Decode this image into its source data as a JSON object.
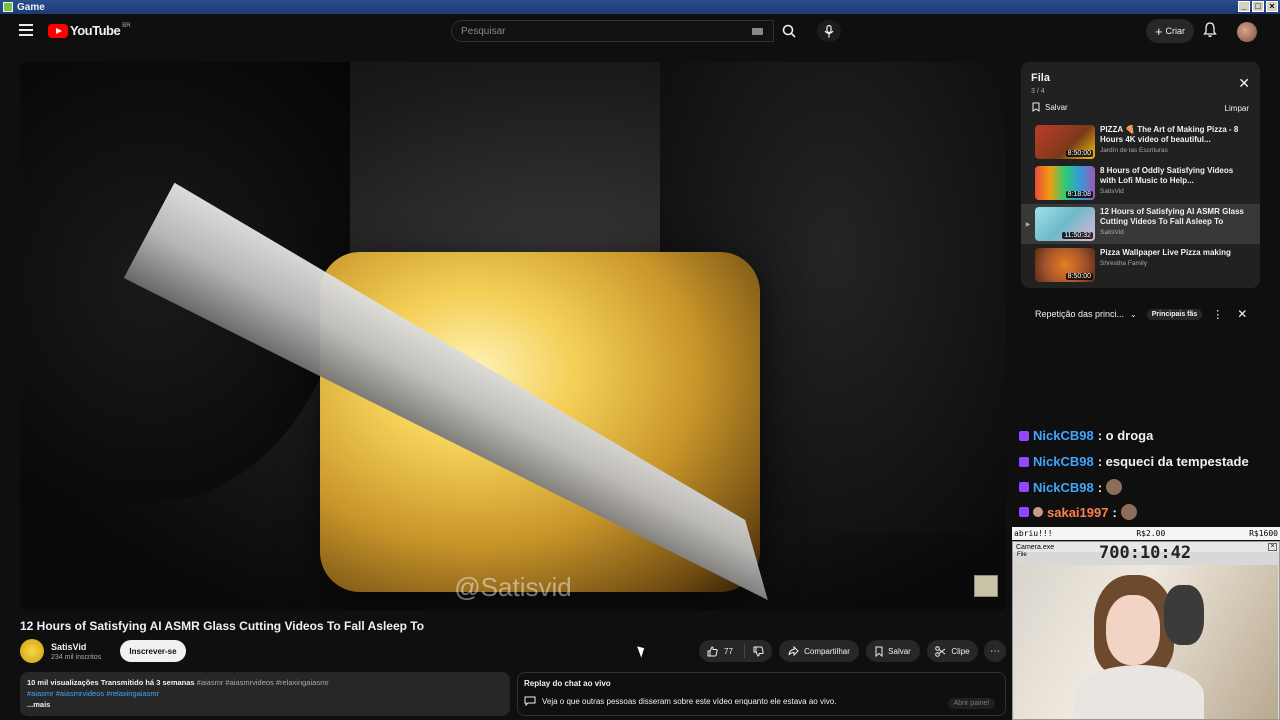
{
  "window": {
    "title": "Game"
  },
  "header": {
    "logo_text": "YouTube",
    "country": "BR",
    "search_placeholder": "Pesquisar",
    "create_label": "Criar"
  },
  "video": {
    "watermark": "@Satisvid",
    "title": "12 Hours of Satisfying AI ASMR Glass Cutting Videos To Fall Asleep To",
    "channel": "SatisVid",
    "subscribers": "234 mil inscritos",
    "subscribe_label": "Inscrever-se",
    "likes": "77",
    "share_label": "Compartilhar",
    "save_label": "Salvar",
    "clip_label": "Clipe"
  },
  "description": {
    "views_date": "10 mil visualizações  Transmitido há 3 semanas",
    "tags_inline": "#aiasmr #aiasmrvideos #relaxingaiasmr",
    "tags_line2": "#aiasmr #aiasmrvideos #relaxingaiasmr",
    "more": "...mais"
  },
  "replay": {
    "title": "Replay do chat ao vivo",
    "text": "Veja o que outras pessoas disseram sobre este vídeo enquanto ele estava ao vivo.",
    "button": "Abrir painel"
  },
  "queue": {
    "title": "Fila",
    "count": "3 / 4",
    "save": "Salvar",
    "clear": "Limpar",
    "items": [
      {
        "title": "PIZZA 🍕 The Art of Making Pizza - 8 Hours 4K video of beautiful...",
        "channel": "Jardín de las Escrituras",
        "duration": "8:50:00",
        "color": "#7a3a1a"
      },
      {
        "title": "8 Hours of Oddly Satisfying Videos with Lofi Music to Help...",
        "channel": "SatisVid",
        "duration": "8:18:08",
        "color": "#4fa06a"
      },
      {
        "title": "12 Hours of Satisfying AI ASMR Glass Cutting Videos To Fall Asleep To",
        "channel": "SatisVid",
        "duration": "11:50:32",
        "color": "#6fb9c9"
      },
      {
        "title": "Pizza Wallpaper Live Pizza making",
        "channel": "Shrestha Family",
        "duration": "8:50:00",
        "color": "#a0522d"
      }
    ]
  },
  "chat": {
    "header": "Repetição das princi...",
    "badge": "Principais fãs",
    "messages": [
      {
        "user": "NickCB98",
        "text": ": o droga",
        "color": "#3ea6ff"
      },
      {
        "user": "NickCB98",
        "text": ": esqueci da tempestade",
        "color": "#3ea6ff"
      },
      {
        "user": "NickCB98",
        "text": ":",
        "color": "#3ea6ff"
      },
      {
        "user": "sakai1997",
        "text": ":",
        "color": "#ff7f50"
      }
    ]
  },
  "overlay": {
    "left": "abriu!!!",
    "mid": "R$2.00",
    "right": "R$1600",
    "cam_title": "Camera.exe",
    "cam_menu": "File",
    "timer": "700:10:42"
  }
}
